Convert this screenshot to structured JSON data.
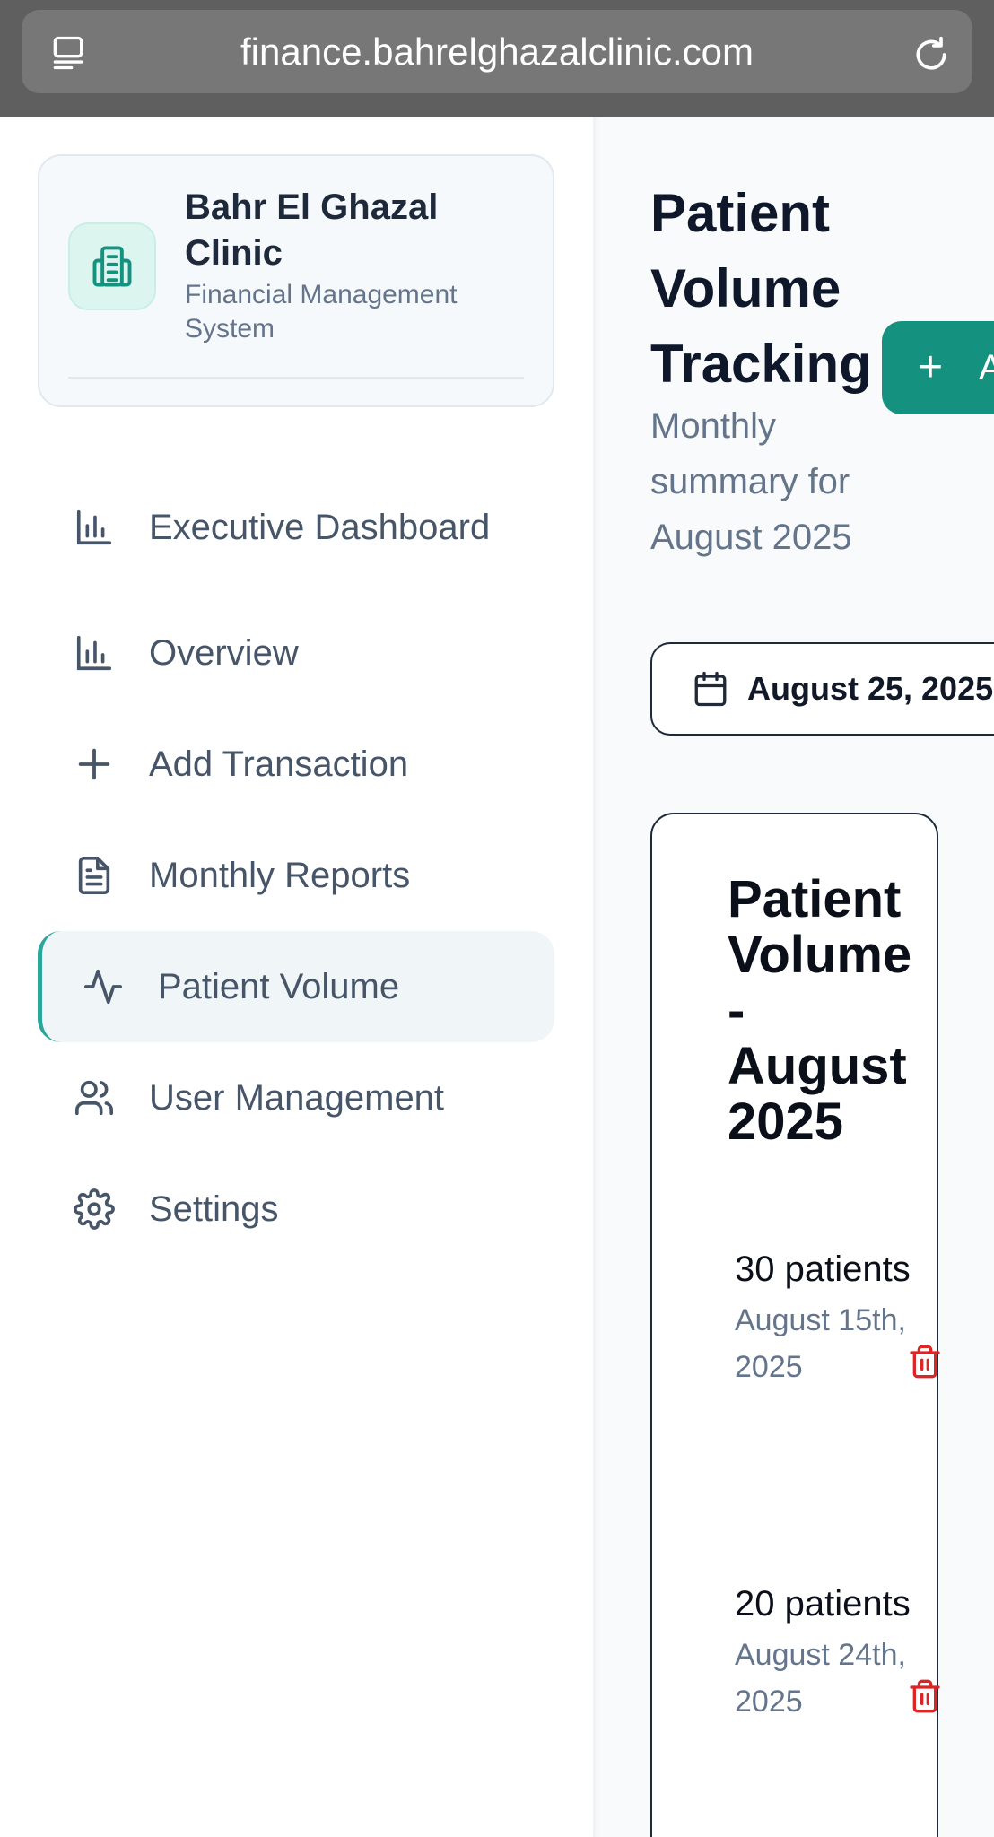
{
  "browser": {
    "url": "finance.bahrelghazalclinic.com",
    "tabs_icon": "tabs-icon",
    "reload_icon": "reload-icon"
  },
  "sidebar": {
    "brand": {
      "name": "Bahr El Ghazal Clinic",
      "subtitle": "Financial Management System",
      "logo_icon": "building-icon"
    },
    "items": [
      {
        "label": "Executive Dashboard",
        "icon": "bar-chart-icon"
      },
      {
        "label": "Overview",
        "icon": "bar-chart-icon"
      },
      {
        "label": "Add Transaction",
        "icon": "plus-icon"
      },
      {
        "label": "Monthly Reports",
        "icon": "document-icon"
      },
      {
        "label": "Patient Volume",
        "icon": "activity-icon",
        "active": true
      },
      {
        "label": "User Management",
        "icon": "users-icon"
      },
      {
        "label": "Settings",
        "icon": "gear-icon"
      }
    ]
  },
  "main": {
    "title": "Patient Volume Tracking",
    "subtitle": "Monthly summary for August 2025",
    "add_button": {
      "icon": "+",
      "label": "Add"
    },
    "date_picker": {
      "value": "August 25, 2025",
      "icon": "calendar-icon"
    },
    "volume_card": {
      "title": "Patient Volume - August 2025",
      "entries": [
        {
          "count": "30 patients",
          "date": "August 15th, 2025"
        },
        {
          "count": "20 patients",
          "date": "August 24th, 2025"
        }
      ]
    }
  },
  "colors": {
    "accent": "#14917f",
    "active_border": "#2aa79a",
    "danger": "#dc2626",
    "chrome": "#5f5f5f"
  }
}
